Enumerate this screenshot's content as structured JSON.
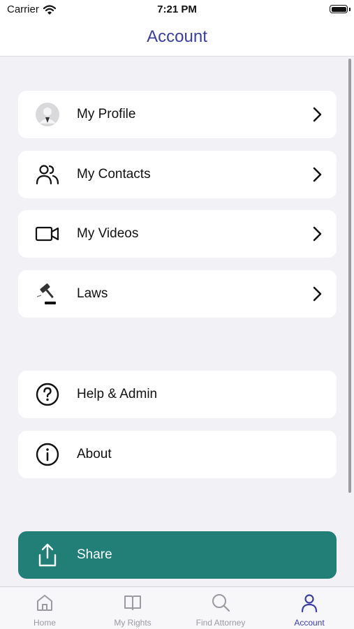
{
  "status_bar": {
    "carrier": "Carrier",
    "time": "7:21 PM"
  },
  "nav": {
    "title": "Account"
  },
  "menu": {
    "group1": [
      {
        "label": "My Profile",
        "icon": "avatar-icon"
      },
      {
        "label": "My Contacts",
        "icon": "contacts-icon"
      },
      {
        "label": "My Videos",
        "icon": "video-camera-icon"
      },
      {
        "label": "Laws",
        "icon": "gavel-icon"
      }
    ],
    "group2": [
      {
        "label": "Help & Admin",
        "icon": "question-circle-icon"
      },
      {
        "label": "About",
        "icon": "info-circle-icon"
      }
    ]
  },
  "share": {
    "label": "Share",
    "icon": "share-icon"
  },
  "tabs": [
    {
      "label": "Home",
      "icon": "home-icon",
      "active": false
    },
    {
      "label": "My Rights",
      "icon": "book-icon",
      "active": false
    },
    {
      "label": "Find Attorney",
      "icon": "search-icon",
      "active": false
    },
    {
      "label": "Account",
      "icon": "person-icon",
      "active": true
    }
  ],
  "colors": {
    "accent": "#3a3fa0",
    "share_bg": "#217f78",
    "background": "#f2f2f6",
    "tab_inactive": "#9a9aa0"
  }
}
